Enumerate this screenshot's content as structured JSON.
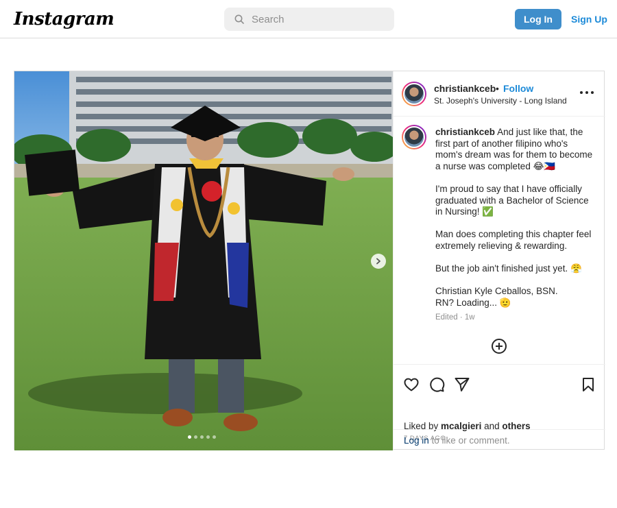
{
  "nav": {
    "logo": "Instagram",
    "search_placeholder": "Search",
    "login_label": "Log In",
    "signup_label": "Sign Up"
  },
  "post": {
    "username": "christiankceb",
    "separator": "•",
    "follow_label": "Follow",
    "location": "St. Joseph's University - Long Island",
    "caption_username": "christiankceb",
    "caption_paragraphs": [
      "And just like that, the first part of another filipino who's mom's dream was for them to become a nurse was completed 😂🇵🇭",
      "I'm proud to say that I have officially graduated with a Bachelor of Science in Nursing! ✅",
      "Man does completing this chapter feel extremely relieving & rewarding.",
      "But the job ain't finished just yet. 😤",
      "Christian Kyle Ceballos, BSN.\nRN? Loading... 🫡"
    ],
    "edited": "Edited",
    "dot": "·",
    "age": "1w",
    "liked_by_prefix": "Liked by ",
    "liked_by_user": "mcalgieri",
    "liked_by_and": " and ",
    "liked_by_others": "others",
    "posted_ago": "7 DAYS AGO",
    "login_link": "Log in",
    "login_suffix": " to like or comment.",
    "carousel": {
      "slide_count": 5,
      "active_index": 0
    }
  },
  "icons": {
    "search": "search-icon",
    "more": "more-options-icon",
    "next": "chevron-right-icon",
    "add": "plus-circle-icon",
    "like": "heart-icon",
    "comment": "comment-icon",
    "share": "paper-plane-icon",
    "save": "bookmark-icon"
  },
  "colors": {
    "primary_button": "#3f8ecb",
    "link": "#1c8ad8",
    "muted_text": "#8e8e8e"
  }
}
